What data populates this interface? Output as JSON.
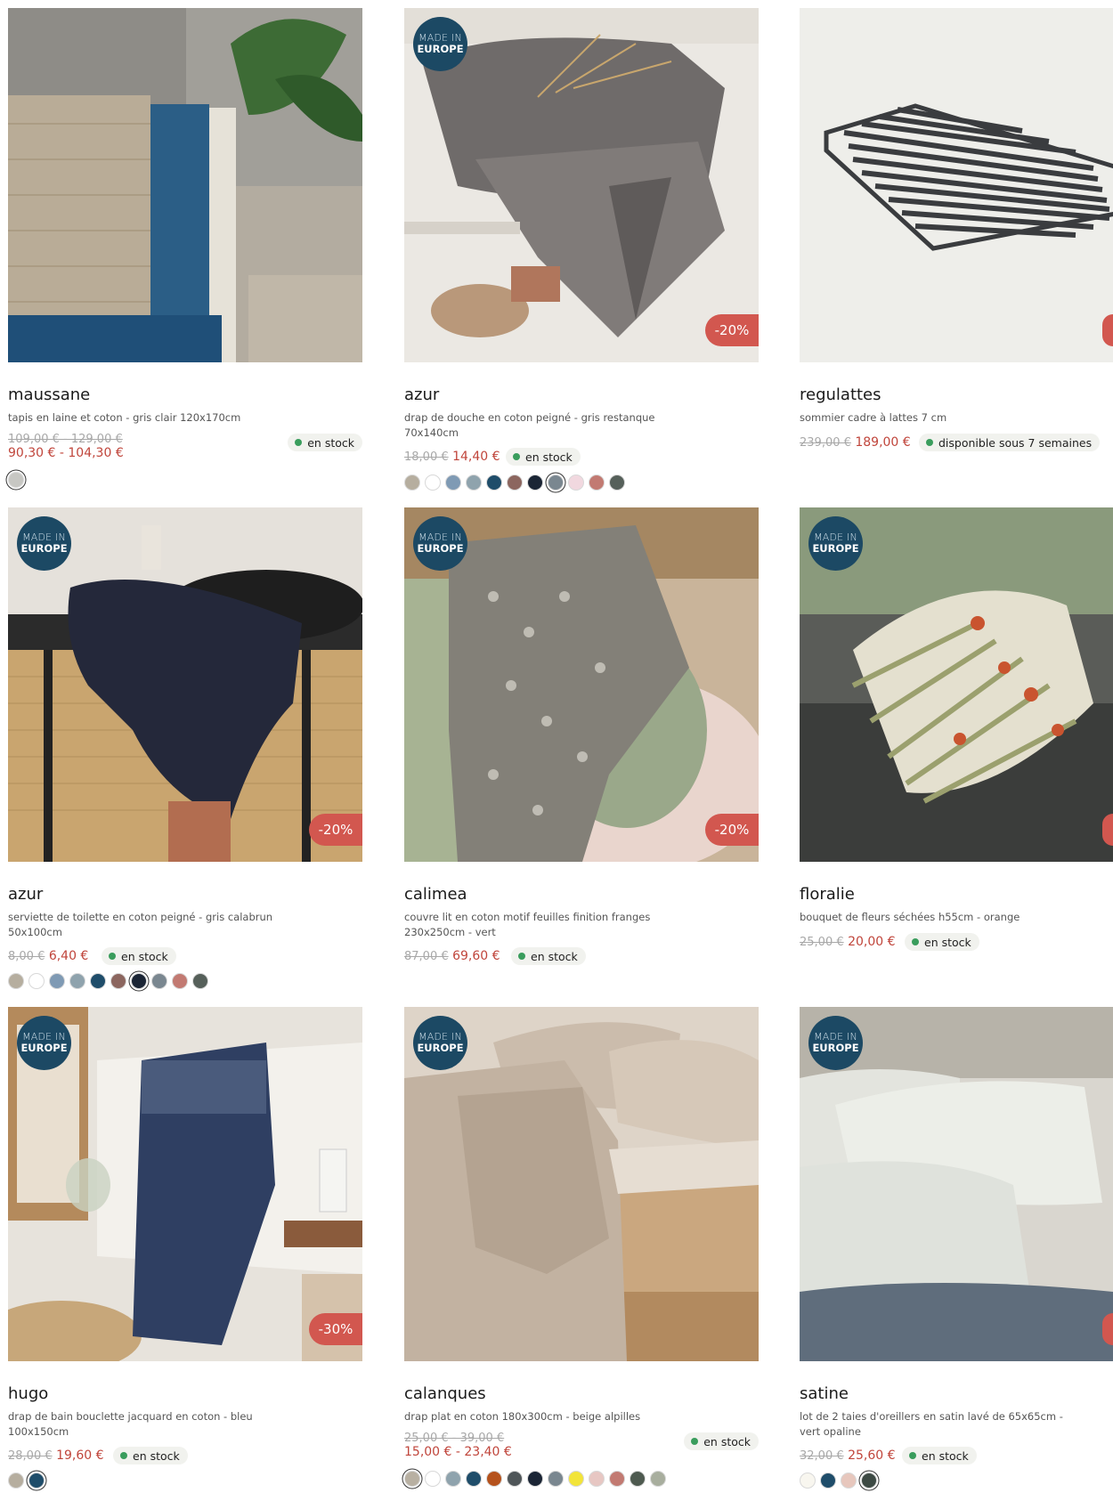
{
  "products": [
    {
      "title": "maussane",
      "desc": "tapis en laine et coton - gris clair 120x170cm",
      "old_price": "109,00 € - 129,00 €",
      "new_price": "90,30 € - 104,30 €",
      "stock": "en stock",
      "made_in": null,
      "discount": null,
      "swatches": [
        "#c7c7c3"
      ],
      "selected": 0
    },
    {
      "title": "azur",
      "desc": "drap de douche en coton peigné - gris restanque 70x140cm",
      "old_price": "18,00 €",
      "new_price": "14,40 €",
      "stock": "en stock",
      "made_in": [
        "MADE IN",
        "EUROPE"
      ],
      "discount": "-20%",
      "swatches": [
        "#b6ae9f",
        "#ffffff",
        "#7f9ab4",
        "#8fa3ad",
        "#1f4d6a",
        "#8c665f",
        "#1b2535",
        "#7a8790",
        "#f1d8df",
        "#c27a72",
        "#56605a"
      ],
      "selected": 7
    },
    {
      "title": "regulattes",
      "desc": "sommier cadre à lattes 7 cm",
      "old_price": "239,00 €",
      "new_price": "189,00 €",
      "stock": "disponible sous 7 semaines",
      "made_in": null,
      "discount": null,
      "swatches": [],
      "selected": -1
    },
    {
      "title": "azur",
      "desc": "serviette de toilette en coton peigné - gris calabrun 50x100cm",
      "old_price": "8,00 €",
      "new_price": "6,40 €",
      "stock": "en stock",
      "made_in": [
        "MADE IN",
        "EUROPE"
      ],
      "discount": "-20%",
      "swatches": [
        "#b6ae9f",
        "#ffffff",
        "#7f9ab4",
        "#8fa3ad",
        "#1f4d6a",
        "#8c665f",
        "#1b2535",
        "#7a8790",
        "#c27a72",
        "#56605a"
      ],
      "selected": 6
    },
    {
      "title": "calimea",
      "desc": "couvre lit en coton motif feuilles finition franges 230x250cm - vert",
      "old_price": "87,00 €",
      "new_price": "69,60 €",
      "stock": "en stock",
      "made_in": [
        "MADE IN",
        "EUROPE"
      ],
      "discount": "-20%",
      "swatches": [],
      "selected": -1
    },
    {
      "title": "floralie",
      "desc": "bouquet de fleurs séchées h55cm - orange",
      "old_price": "25,00 €",
      "new_price": "20,00 €",
      "stock": "en stock",
      "made_in": [
        "MADE IN",
        "EUROPE"
      ],
      "discount": null,
      "swatches": [],
      "selected": -1
    },
    {
      "title": "hugo",
      "desc": "drap de bain bouclette jacquard en coton - bleu 100x150cm",
      "old_price": "28,00 €",
      "new_price": "19,60 €",
      "stock": "en stock",
      "made_in": [
        "MADE IN",
        "EUROPE"
      ],
      "discount": "-30%",
      "swatches": [
        "#b6ae9f",
        "#1f4d6a"
      ],
      "selected": 1
    },
    {
      "title": "calanques",
      "desc": "drap plat en coton 180x300cm - beige alpilles",
      "old_price": "25,00 € - 39,00 €",
      "new_price": "15,00 € - 23,40 €",
      "stock": "en stock",
      "made_in": [
        "MADE IN",
        "EUROPE"
      ],
      "discount": null,
      "swatches": [
        "#b8b0a2",
        "#ffffff",
        "#8fa3ad",
        "#1f4d6a",
        "#b5521c",
        "#4f5659",
        "#1b2535",
        "#7a8790",
        "#f2e43a",
        "#e7c7c3",
        "#c27a72",
        "#4e5a50",
        "#a8ae9e"
      ],
      "selected": 0
    },
    {
      "title": "satine",
      "desc": "lot de 2 taies d'oreillers en satin lavé de 65x65cm - vert opaline",
      "old_price": "32,00 €",
      "new_price": "25,60 €",
      "stock": "en stock",
      "made_in": [
        "MADE IN",
        "EUROPE"
      ],
      "discount": null,
      "swatches": [
        "#f8f6ef",
        "#1f4d6a",
        "#e7c7bd",
        "#3d4a44"
      ],
      "selected": 3
    }
  ],
  "colors": {
    "made_in_badge": "#1c4964",
    "discount": "#d2574f",
    "price_new": "#c0453b",
    "stock_dot": "#3a9d5d"
  }
}
